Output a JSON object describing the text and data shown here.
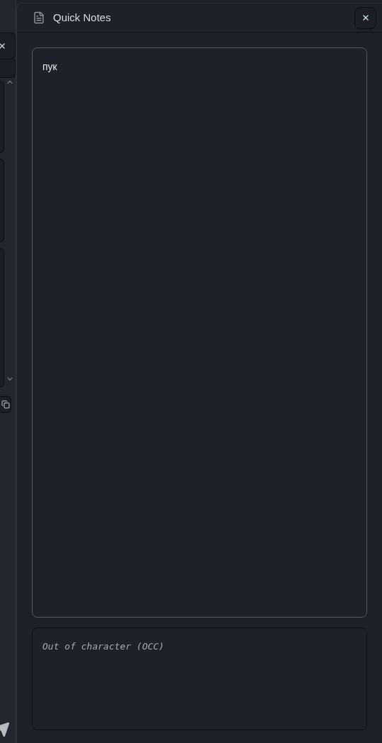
{
  "panel": {
    "title": "Quick Notes"
  },
  "notes": {
    "value": "пук"
  },
  "occ": {
    "placeholder": "Out of character (OCC)"
  }
}
